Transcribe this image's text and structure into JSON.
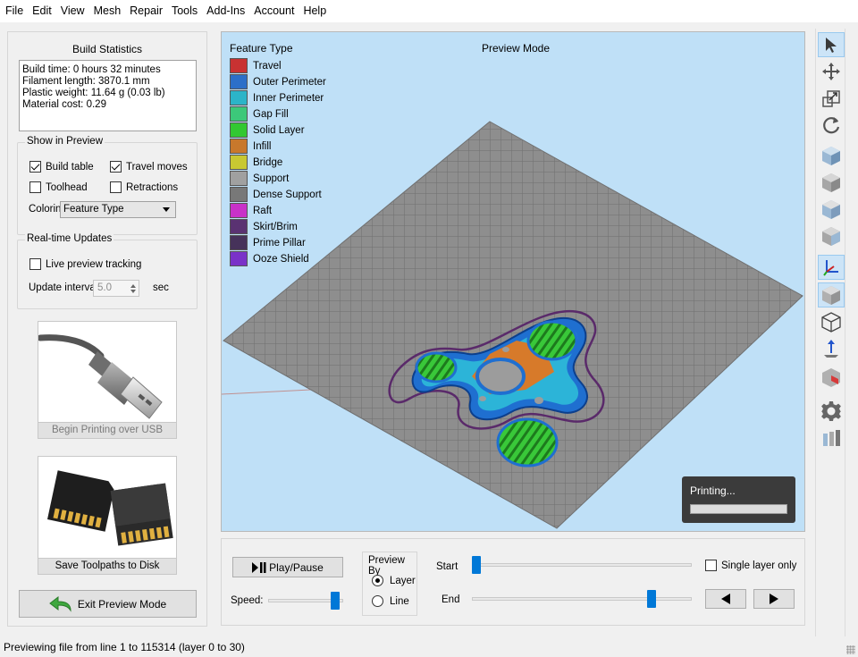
{
  "menu": [
    "File",
    "Edit",
    "View",
    "Mesh",
    "Repair",
    "Tools",
    "Add-Ins",
    "Account",
    "Help"
  ],
  "stats": {
    "title": "Build Statistics",
    "lines": [
      "Build time: 0 hours 32 minutes",
      "Filament length: 3870.1 mm",
      "Plastic weight: 11.64 g (0.03 lb)",
      "Material cost: 0.29"
    ]
  },
  "show_in_preview": {
    "title": "Show in Preview",
    "build_table": "Build table",
    "travel_moves": "Travel moves",
    "toolhead": "Toolhead",
    "retractions": "Retractions",
    "coloring_label": "Coloring",
    "coloring_value": "Feature Type"
  },
  "realtime": {
    "title": "Real-time Updates",
    "live_preview": "Live preview tracking",
    "interval_label": "Update interval",
    "interval_value": "5.0",
    "interval_unit": "sec"
  },
  "usb_button": "Begin Printing over USB",
  "sd_button": "Save Toolpaths to Disk",
  "exit_button": "Exit Preview Mode",
  "viewport": {
    "legend_title": "Feature Type",
    "mode_title": "Preview Mode",
    "printing": "Printing..."
  },
  "legend": [
    {
      "label": "Travel",
      "color": "#c83232"
    },
    {
      "label": "Outer Perimeter",
      "color": "#2c6fc8"
    },
    {
      "label": "Inner Perimeter",
      "color": "#2cb4c8"
    },
    {
      "label": "Gap Fill",
      "color": "#3cc87a"
    },
    {
      "label": "Solid Layer",
      "color": "#32c832"
    },
    {
      "label": "Infill",
      "color": "#c8782c"
    },
    {
      "label": "Bridge",
      "color": "#c8c832"
    },
    {
      "label": "Support",
      "color": "#a0a0a0"
    },
    {
      "label": "Dense Support",
      "color": "#787878"
    },
    {
      "label": "Raft",
      "color": "#c832c8"
    },
    {
      "label": "Skirt/Brim",
      "color": "#5a3272"
    },
    {
      "label": "Prime Pillar",
      "color": "#46325a"
    },
    {
      "label": "Ooze Shield",
      "color": "#7a32c8"
    }
  ],
  "controls": {
    "play_pause": "Play/Pause",
    "speed_label": "Speed:",
    "preview_by_title": "Preview By",
    "layer": "Layer",
    "line": "Line",
    "start_label": "Start",
    "end_label": "End",
    "single_layer": "Single layer only",
    "speed_value": 0.95,
    "start_value": 0.0,
    "end_value": 0.83
  },
  "status": "Previewing file from line 1 to 115314 (layer 0 to 30)"
}
